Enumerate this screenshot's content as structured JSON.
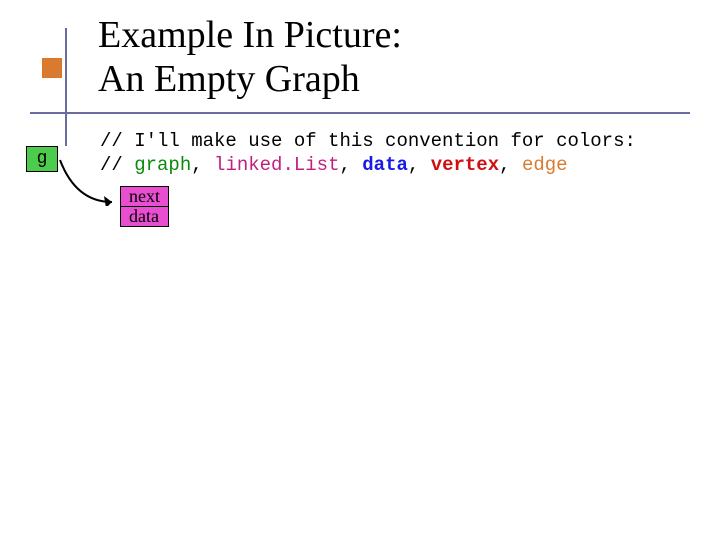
{
  "title": {
    "line1": "Example In Picture:",
    "line2": "An Empty Graph"
  },
  "code": {
    "comment1": "// I'll make use of this convention for colors:",
    "comment2_prefix": "// ",
    "graph": "graph",
    "sep1": ", ",
    "linkedList": "linked.List",
    "sep2": ", ",
    "data": "data",
    "sep3": ", ",
    "vertex": "vertex",
    "sep4": ", ",
    "edge": "edge"
  },
  "boxes": {
    "g": "g",
    "node_next": "next",
    "node_data": "data"
  }
}
